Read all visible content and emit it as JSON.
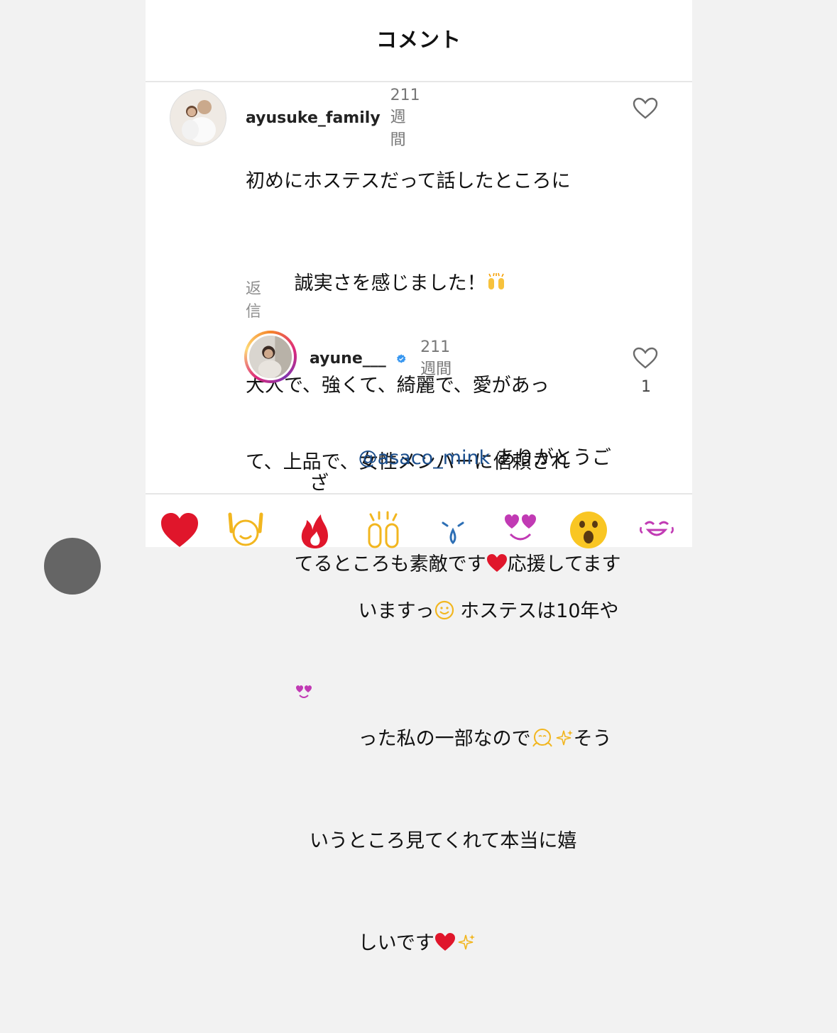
{
  "header": {
    "title": "コメント"
  },
  "comments": [
    {
      "username": "ayusuke_family",
      "time": "211週間",
      "lines": [
        "初めにホステスだって話したところに",
        "誠実さを感じました！",
        "大人で、強くて、綺麗で、愛があっ",
        "て、上品で、女性メンバーに信頼され",
        "てるところも素敵です",
        "応援してます"
      ],
      "reply_label": "返信",
      "emoji": [
        "raised-hands-emoji",
        "red-heart-emoji",
        "heart-eyes-emoji"
      ]
    },
    {
      "username": "ayune___",
      "verified": true,
      "time": "211週間",
      "mention": "@asaco_mink",
      "lines": [
        " ありがとうござ",
        "いますっ",
        " ホステスは10年や",
        "った私の一部なので",
        "そう",
        "いうところ見てくれて本当に嬉",
        "しいです"
      ],
      "like_count": "1",
      "emoji": [
        "smiley-emoji",
        "hugging-face-emoji",
        "sparkles-emoji",
        "red-heart-emoji",
        "sparkles-emoji"
      ]
    }
  ],
  "reaction_bar": [
    "red-heart-emoji",
    "raising-hands-emoji",
    "fire-emoji",
    "clapping-hands-emoji",
    "crying-face-emoji",
    "heart-eyes-emoji",
    "astonished-face-emoji",
    "laughing-tears-emoji"
  ],
  "colors": {
    "mention": "#1b4e8c",
    "verified": "#3897f0",
    "heart": "#e0162b",
    "meta_gray": "#777777"
  }
}
